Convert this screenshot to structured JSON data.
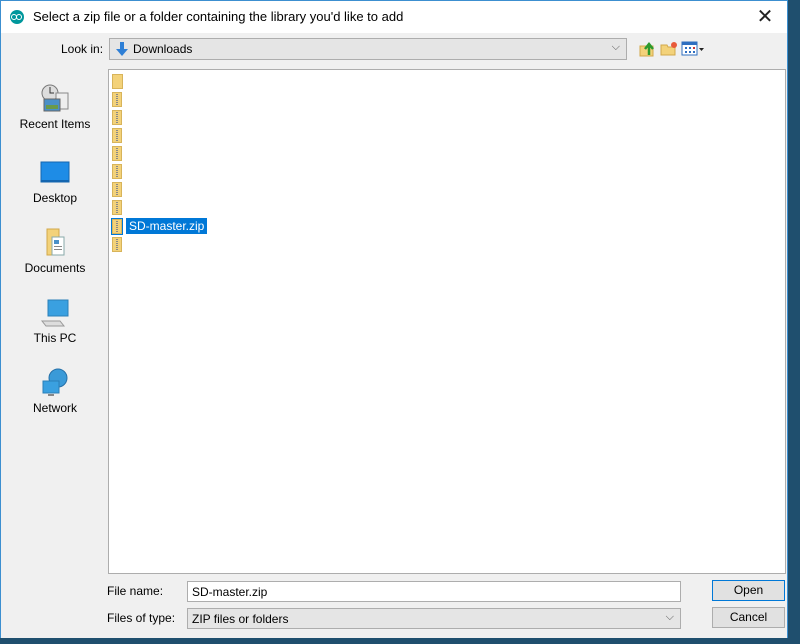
{
  "title": "Select a zip file or a folder containing the library you'd like to add",
  "close_glyph": "✕",
  "look_in": {
    "label": "Look in:",
    "value": "Downloads",
    "chevron": "⌵"
  },
  "toolbar": {
    "up_folder": "up-one-level",
    "new_folder": "create-new-folder",
    "view_menu": "view-menu"
  },
  "places": [
    {
      "label": "Recent Items",
      "icon": "recent-items-icon"
    },
    {
      "label": "Desktop",
      "icon": "desktop-icon"
    },
    {
      "label": "Documents",
      "icon": "documents-icon"
    },
    {
      "label": "This PC",
      "icon": "this-pc-icon"
    },
    {
      "label": "Network",
      "icon": "network-icon"
    }
  ],
  "files": [
    {
      "type": "folder",
      "name": ""
    },
    {
      "type": "zip",
      "name": ""
    },
    {
      "type": "zip",
      "name": ""
    },
    {
      "type": "zip",
      "name": ""
    },
    {
      "type": "zip",
      "name": ""
    },
    {
      "type": "zip",
      "name": ""
    },
    {
      "type": "zip",
      "name": ""
    },
    {
      "type": "zip",
      "name": ""
    },
    {
      "type": "zip",
      "name": "SD-master.zip",
      "selected": true
    },
    {
      "type": "zip",
      "name": ""
    }
  ],
  "file_name": {
    "label": "File name:",
    "value": "SD-master.zip"
  },
  "files_of_type": {
    "label": "Files of type:",
    "value": "ZIP files or folders",
    "chevron": "⌵"
  },
  "buttons": {
    "open": "Open",
    "cancel": "Cancel"
  },
  "colors": {
    "selection": "#0078d7",
    "arduino_teal": "#00979c",
    "window_border": "#3c8fd0"
  }
}
